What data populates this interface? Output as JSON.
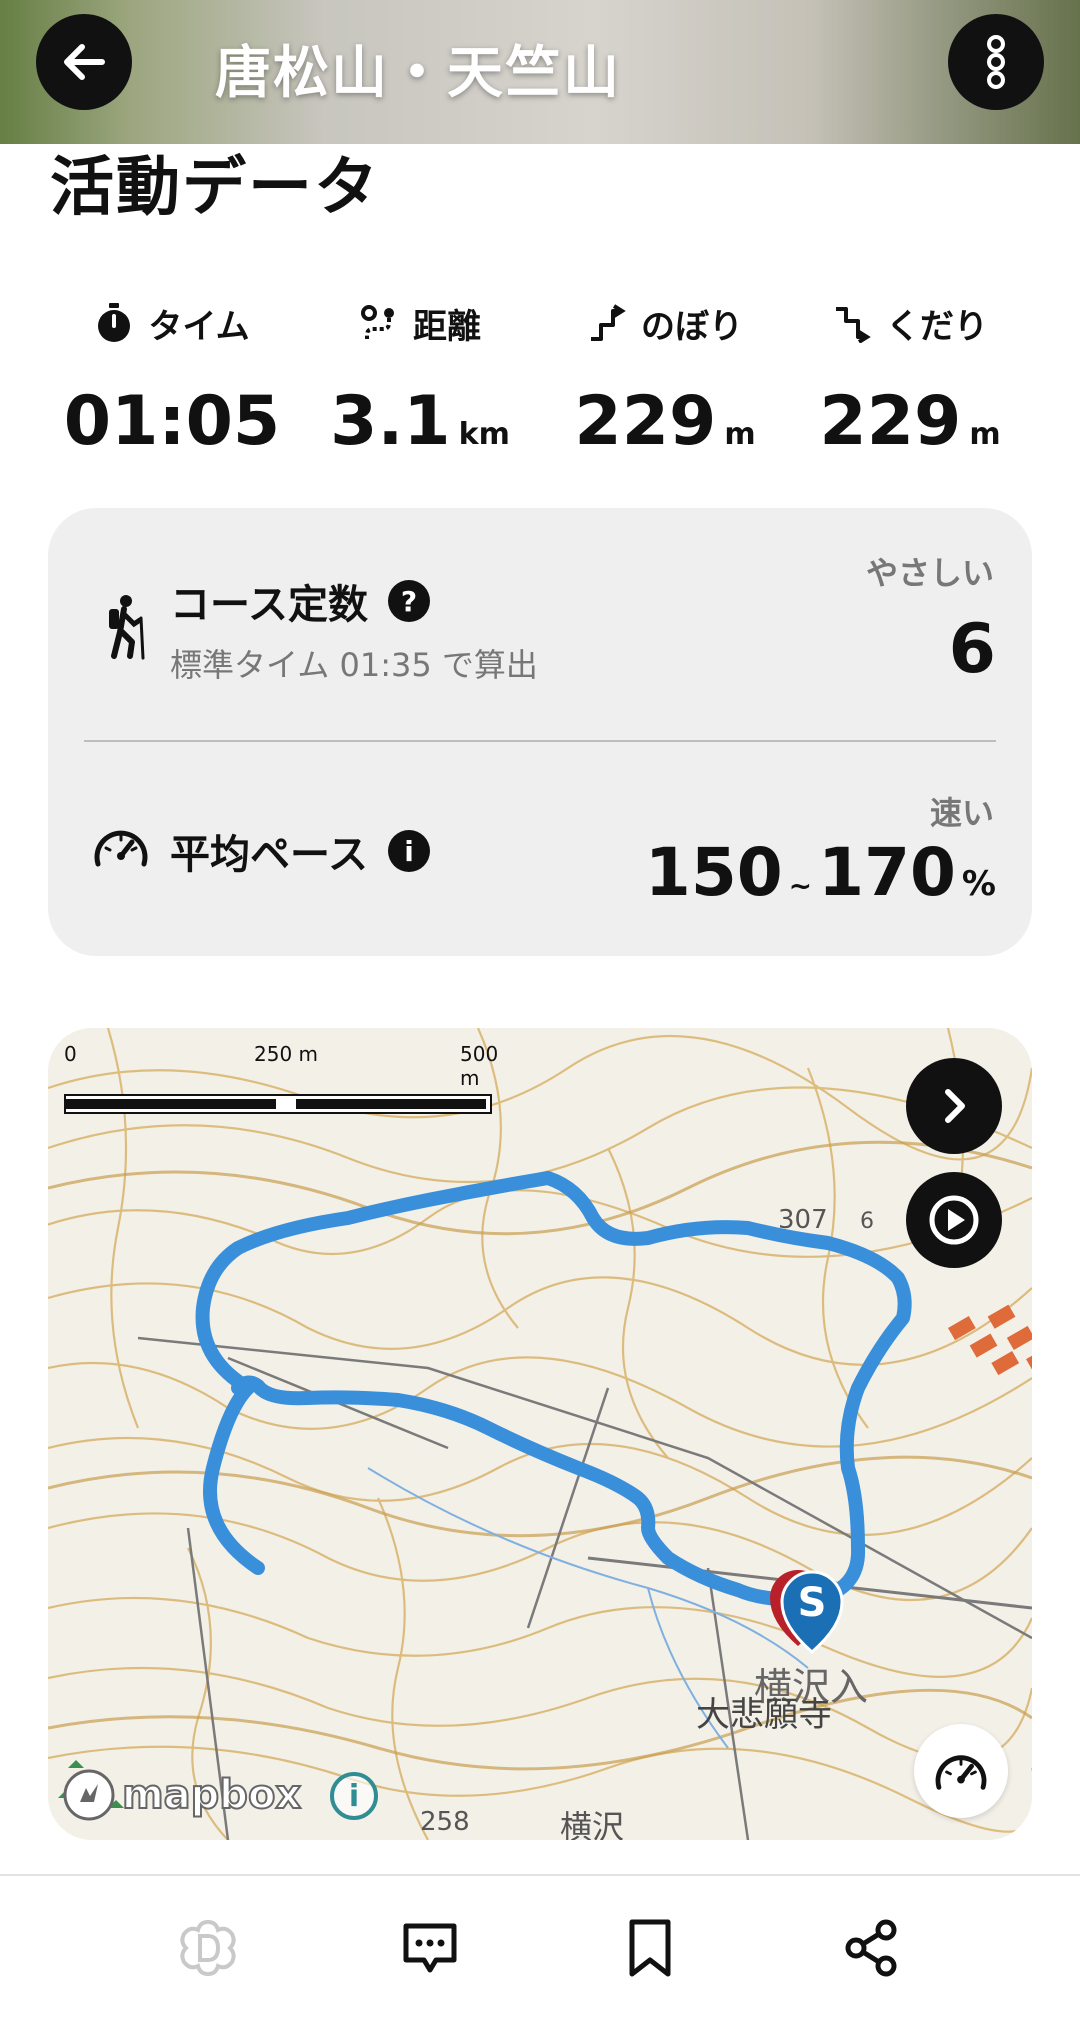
{
  "header": {
    "title": "唐松山・天竺山"
  },
  "section_title": "活動データ",
  "stats": [
    {
      "label": "タイム",
      "icon": "stopwatch-icon",
      "value": "01:05",
      "unit": ""
    },
    {
      "label": "距離",
      "icon": "route-icon",
      "value": "3.1",
      "unit": "km"
    },
    {
      "label": "のぼり",
      "icon": "uphill-icon",
      "value": "229",
      "unit": "m"
    },
    {
      "label": "くだり",
      "icon": "downhill-icon",
      "value": "229",
      "unit": "m"
    }
  ],
  "course_constant": {
    "title": "コース定数",
    "help_symbol": "?",
    "subtitle": "標準タイム 01:35 で算出",
    "tag": "やさしい",
    "value": "6"
  },
  "average_pace": {
    "title": "平均ペース",
    "info_symbol": "i",
    "tag": "速い",
    "min": "150",
    "range_sep": "~",
    "max": "170",
    "unit": "%"
  },
  "map": {
    "scale_labels": [
      "0",
      "250 m",
      "500 m"
    ],
    "attribution": "mapbox",
    "info_symbol": "i",
    "start_marker_label": "S",
    "place_labels": [
      "307",
      "6",
      "横沢入",
      "大悲願寺",
      "258",
      "横沢"
    ],
    "route_color": "#3a8fdb"
  },
  "bottom_nav": [
    "diary-icon",
    "comment-icon",
    "bookmark-icon",
    "share-icon"
  ],
  "colors": {
    "route": "#3a8fdb",
    "contour": "#d8b26a",
    "card_bg": "#efefef"
  }
}
